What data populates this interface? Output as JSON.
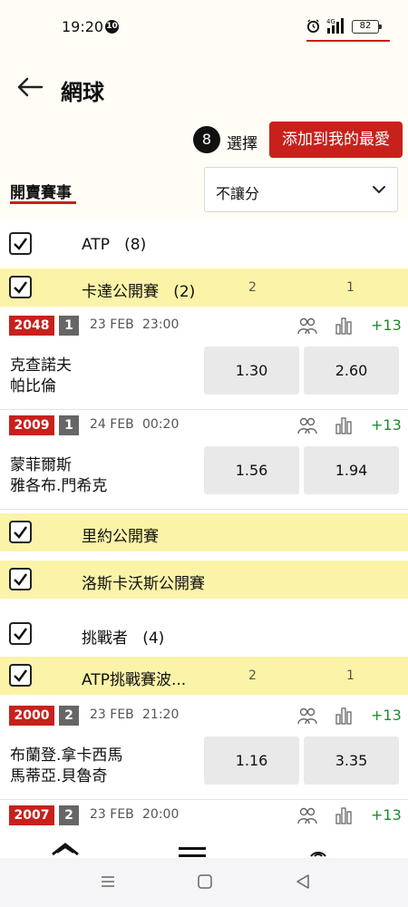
{
  "status_bar": {
    "time": "19:20",
    "notification_count": "10",
    "battery": "82"
  },
  "header": {
    "title": "網球",
    "selected_count": "8",
    "select_label": "選擇",
    "add_favorites_label": "添加到我的最愛",
    "tab_on_sale": "開賣賽事",
    "handicap_value": "不讓分"
  },
  "rows": {
    "atp": {
      "label": "ATP",
      "count": "(8)"
    },
    "qatar": {
      "label": "卡達公開賽",
      "count": "(2)",
      "col1": "2",
      "col2": "1"
    },
    "rio": {
      "label": "里約公開賽"
    },
    "los_cabos": {
      "label": "洛斯卡沃斯公開賽"
    },
    "challenger": {
      "label": "挑戰者",
      "count": "(4)"
    },
    "atp_challenger": {
      "label": "ATP挑戰賽波...",
      "col1": "2",
      "col2": "1"
    }
  },
  "matches": [
    {
      "id": "2048",
      "round": "1",
      "date": "23 FEB",
      "time": "23:00",
      "more": "+13",
      "player1": "克查諾夫",
      "player2": "帕比倫",
      "odds1": "1.30",
      "odds2": "2.60"
    },
    {
      "id": "2009",
      "round": "1",
      "date": "24 FEB",
      "time": "00:20",
      "more": "+13",
      "player1": "蒙菲爾斯",
      "player2": "雅各布.門希克",
      "odds1": "1.56",
      "odds2": "1.94"
    },
    {
      "id": "2000",
      "round": "2",
      "date": "23 FEB",
      "time": "21:20",
      "more": "+13",
      "player1": "布蘭登.拿卡西馬",
      "player2": "馬蒂亞.貝魯奇",
      "odds1": "1.16",
      "odds2": "3.35"
    },
    {
      "id": "2007",
      "round": "2",
      "date": "23 FEB",
      "time": "20:00",
      "more": "+13"
    }
  ],
  "colors": {
    "accent": "#c8211c",
    "league_bg": "#fbf3a7",
    "odds_bg": "#e9e9e9",
    "plus_green": "#1c8c2a"
  },
  "icons": [
    "back-arrow-icon",
    "chevron-down-icon",
    "checkmark-icon",
    "players-icon",
    "stats-icon",
    "home-icon",
    "menu-icon",
    "live-icon"
  ]
}
